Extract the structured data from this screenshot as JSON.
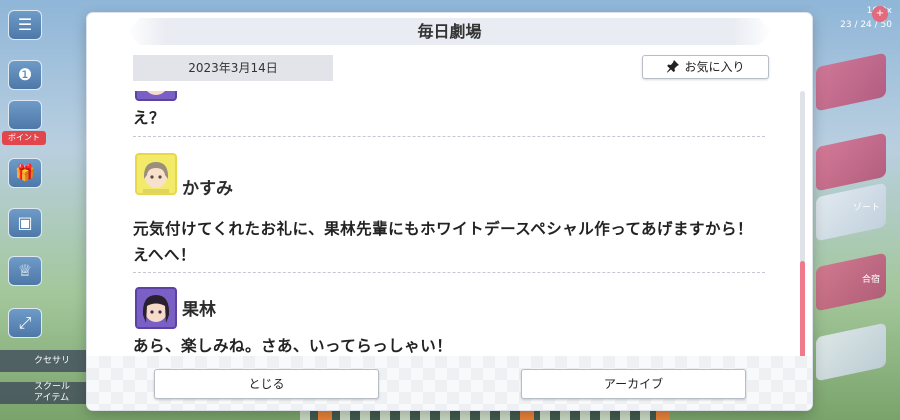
{
  "background": {
    "left_menu": [
      {
        "icon": "menu-icon",
        "glyph": "☰"
      },
      {
        "icon": "chat-bubble-icon",
        "glyph": "❶"
      },
      {
        "icon": "gift-icon",
        "glyph": "🎁"
      },
      {
        "icon": "screen-icon",
        "glyph": "▣"
      },
      {
        "icon": "trophy-icon",
        "glyph": "♕"
      },
      {
        "icon": "expand-icon",
        "glyph": "⤢"
      }
    ],
    "event_badge": "ボイント",
    "bottom_tags": [
      "クセサリ",
      "スクール\nアイテム"
    ],
    "right_info_lines": [
      "16,2x",
      "23 / 24 / 50"
    ],
    "right_labels": [
      "ゾート",
      "合宿"
    ]
  },
  "modal": {
    "title": "毎日劇場",
    "date": "2023年3月14日",
    "favorite_label": "お気に入り",
    "messages": [
      {
        "speaker": "",
        "text": "え？"
      },
      {
        "speaker": "かすみ",
        "text_lines": [
          "元気付けてくれたお礼に、果林先輩にもホワイトデースペシャル作ってあげますから！",
          "えへへ！"
        ]
      },
      {
        "speaker": "果林",
        "text": "あら、楽しみね。さあ、いってらっしゃい！"
      }
    ],
    "close_label": "とじる",
    "archive_label": "アーカイブ"
  },
  "colors": {
    "scroll_thumb": "#f07a8c",
    "kasumi_avatar_bg": "#f4ea6a",
    "karin_avatar_bg": "#7a5fc4"
  }
}
